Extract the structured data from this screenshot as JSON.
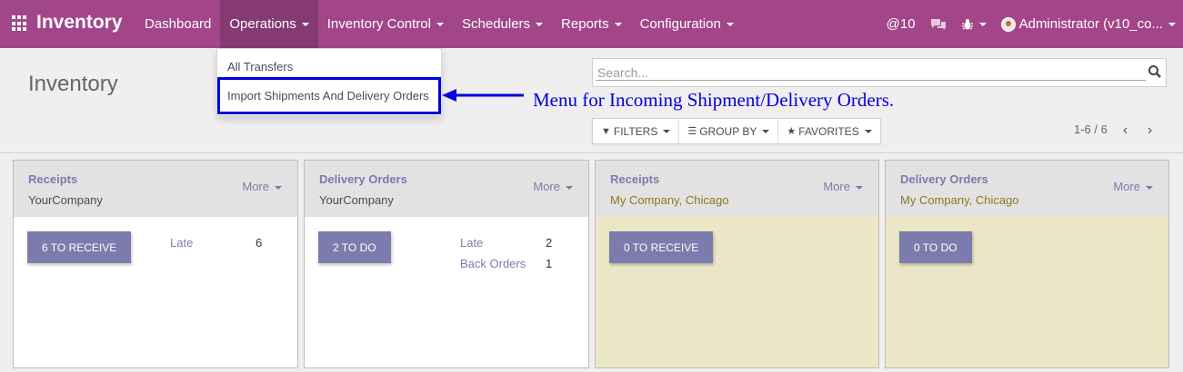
{
  "navbar": {
    "brand": "Inventory",
    "menu": [
      {
        "label": "Dashboard",
        "caret": false
      },
      {
        "label": "Operations",
        "caret": true
      },
      {
        "label": "Inventory Control",
        "caret": true
      },
      {
        "label": "Schedulers",
        "caret": true
      },
      {
        "label": "Reports",
        "caret": true
      },
      {
        "label": "Configuration",
        "caret": true
      }
    ],
    "mentions": "@10",
    "user": "Administrator (v10_co..."
  },
  "dropdown": {
    "items": [
      "All Transfers",
      "Import Shipments And Delivery Orders"
    ]
  },
  "control": {
    "title": "Inventory",
    "search_placeholder": "Search...",
    "annotation": "Menu for Incoming Shipment/Delivery Orders.",
    "filters_label": "FILTERS",
    "groupby_label": "GROUP BY",
    "favorites_label": "FAVORITES",
    "pager": "1-6 / 6"
  },
  "cards": [
    {
      "name": "Receipts",
      "company": "YourCompany",
      "more": "More",
      "action": "6 TO RECEIVE",
      "stats": [
        {
          "label": "Late",
          "value": "6"
        }
      ]
    },
    {
      "name": "Delivery Orders",
      "company": "YourCompany",
      "more": "More",
      "action": "2 TO DO",
      "stats": [
        {
          "label": "Late",
          "value": "2"
        },
        {
          "label": "Back Orders",
          "value": "1"
        }
      ]
    },
    {
      "name": "Receipts",
      "company": "My Company, Chicago",
      "more": "More",
      "action": "0 TO RECEIVE",
      "stats": []
    },
    {
      "name": "Delivery Orders",
      "company": "My Company, Chicago",
      "more": "More",
      "action": "0 TO DO",
      "stats": []
    }
  ],
  "colors": {
    "navbar": "#a24689",
    "accent": "#7c7bad",
    "highlight": "#0000dd",
    "warehouse_card": "#ebe6c5"
  }
}
